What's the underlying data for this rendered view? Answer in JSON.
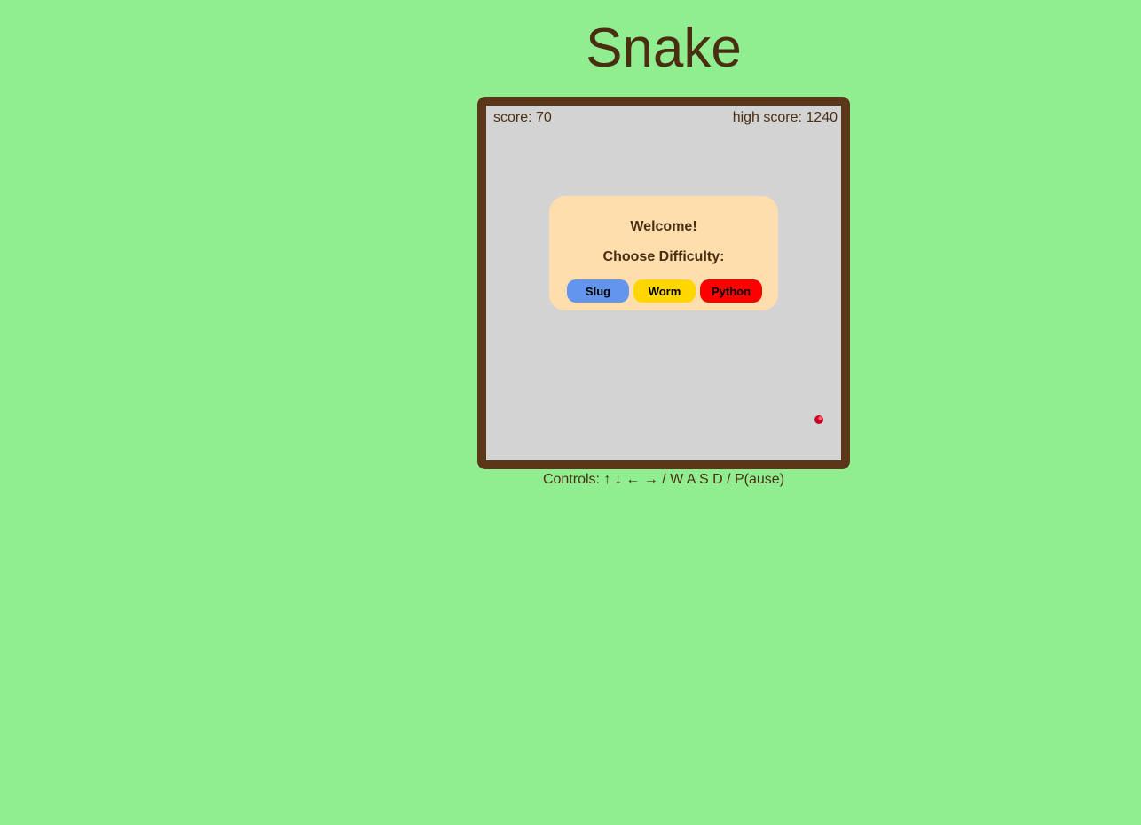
{
  "title": "Snake",
  "scoreboard": {
    "score_text": "score: 70",
    "high_score_text": "high score: 1240"
  },
  "modal": {
    "welcome": "Welcome!",
    "prompt": "Choose Difficulty:",
    "buttons": [
      {
        "label": "Slug",
        "color": "#6495ed"
      },
      {
        "label": "Worm",
        "color": "#ffd700"
      },
      {
        "label": "Python",
        "color": "#ff0000"
      }
    ]
  },
  "controls_text": "Controls: ↑ ↓ ← → / W A S D / P(ause)",
  "colors": {
    "background": "#90ee90",
    "board": "#d3d3d3",
    "frame": "#5a3718",
    "modal": "#ffdead",
    "text": "#4a2e12",
    "apple": "#d0002a"
  },
  "food_icon": "apple-icon"
}
